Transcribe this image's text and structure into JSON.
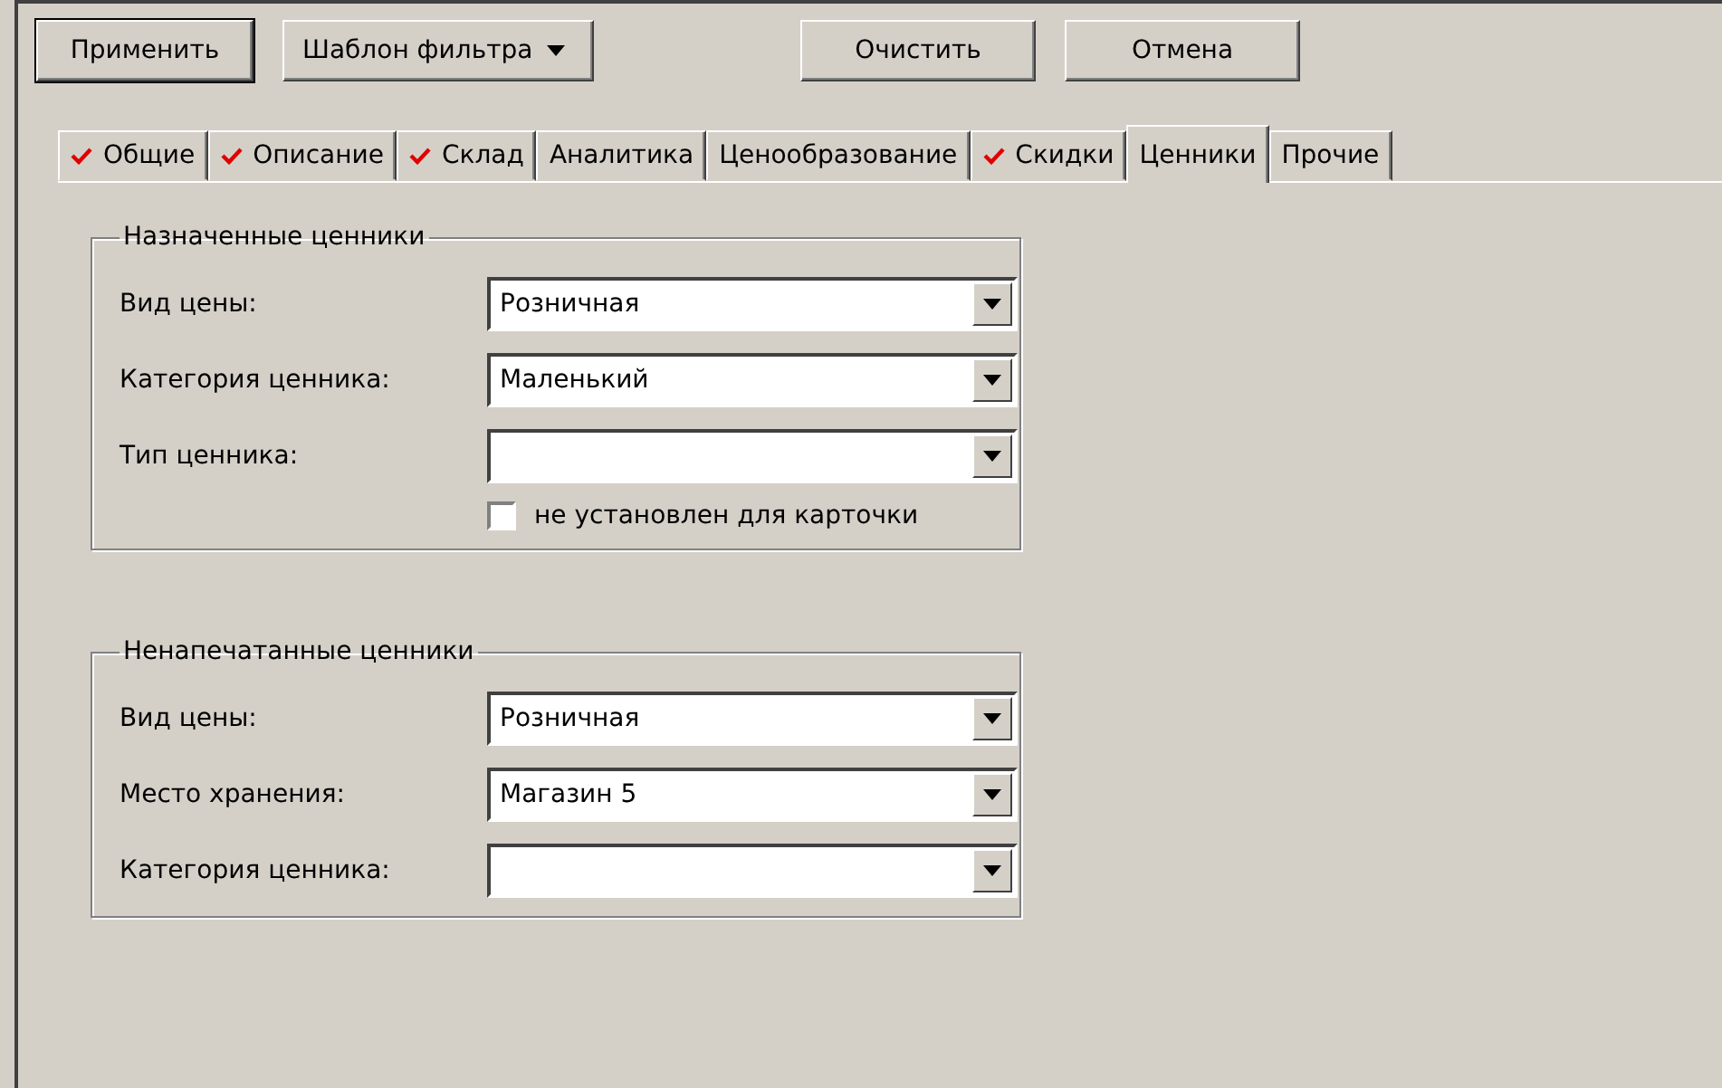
{
  "toolbar": {
    "buttons": [
      {
        "label": "Применить",
        "kind": "default"
      },
      {
        "label": "Шаблон фильтра",
        "kind": "menu"
      },
      {
        "label": "Очистить",
        "kind": "plain"
      },
      {
        "label": "Отмена",
        "kind": "plain"
      }
    ]
  },
  "tabs": [
    {
      "label": "Общие",
      "checked": true,
      "selected": false
    },
    {
      "label": "Описание",
      "checked": true,
      "selected": false
    },
    {
      "label": "Склад",
      "checked": true,
      "selected": false
    },
    {
      "label": "Аналитика",
      "checked": false,
      "selected": false
    },
    {
      "label": "Ценообразование",
      "checked": false,
      "selected": false
    },
    {
      "label": "Скидки",
      "checked": true,
      "selected": false
    },
    {
      "label": "Ценники",
      "checked": false,
      "selected": true
    },
    {
      "label": "Прочие",
      "checked": false,
      "selected": false
    }
  ],
  "groups": [
    {
      "title": "Назначенные ценники",
      "fields": [
        {
          "label": "Вид цены:",
          "value": "Розничная"
        },
        {
          "label": "Категория ценника:",
          "value": "Маленький"
        },
        {
          "label": "Тип ценника:"
        }
      ],
      "checkbox": {
        "label": "не установлен для карточки",
        "checked": false
      }
    },
    {
      "title": "Ненапечатанные ценники",
      "fields": [
        {
          "label": "Вид цены:",
          "value": "Розничная"
        },
        {
          "label": "Место хранения:",
          "value": "Магазин 5"
        },
        {
          "label": "Категория ценника:"
        }
      ]
    }
  ]
}
